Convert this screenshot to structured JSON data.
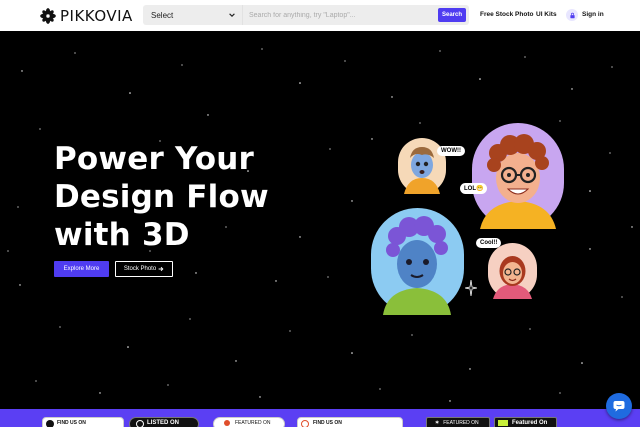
{
  "header": {
    "logo_text": "PIKKOVIA",
    "category_select": "Select",
    "search_placeholder": "Search for anything, try \"Laptop\"...",
    "search_button": "Search",
    "nav": {
      "free_stock_photo": "Free Stock Photo",
      "ui_kits": "UI Kits",
      "sign_in": "Sign in"
    },
    "icons": [
      "logo-flower-icon",
      "chevron-down-icon",
      "lock-icon"
    ]
  },
  "hero": {
    "title_lines": [
      "Power Your",
      "Design Flow",
      "with 3D"
    ],
    "explore_button": "Explore More",
    "stock_button": "Stock Photo",
    "stock_button_icon": "arrow-right-icon"
  },
  "avatars": {
    "bubbles": [
      "WOW!!",
      "LOL😁",
      "Cool!!"
    ]
  },
  "featured_strip": {
    "badges": [
      "FIND US ON",
      "LISTED ON",
      "FEATURED ON",
      "FIND US ON",
      "FEATURED ON",
      "Featured On"
    ]
  },
  "colors": {
    "accent": "#4f3cf1",
    "strip": "#5b3ff3",
    "chat": "#1f6be0",
    "background": "#000000"
  }
}
